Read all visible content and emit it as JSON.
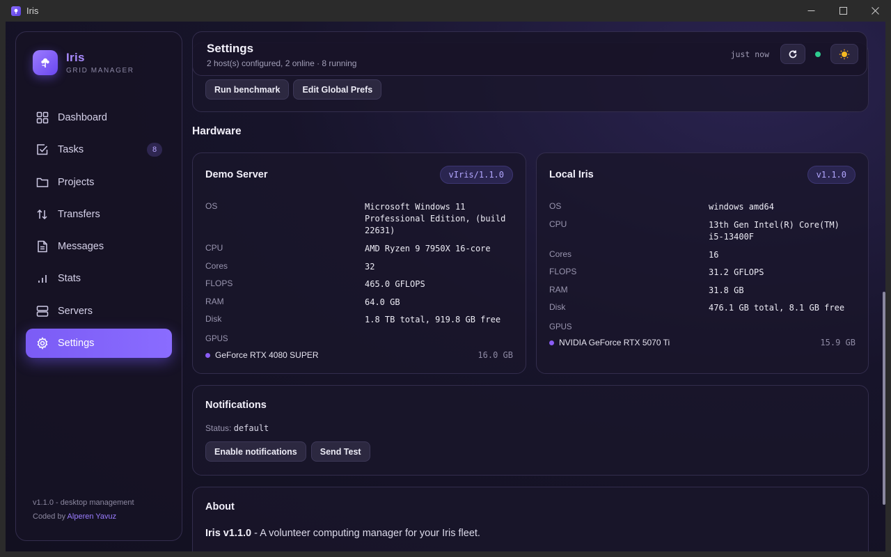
{
  "window": {
    "title": "Iris"
  },
  "brand": {
    "name": "Iris",
    "subtitle": "GRID MANAGER"
  },
  "nav": {
    "items": [
      {
        "label": "Dashboard",
        "icon": "grid-icon"
      },
      {
        "label": "Tasks",
        "icon": "checkbox-icon",
        "badge": "8"
      },
      {
        "label": "Projects",
        "icon": "folder-icon"
      },
      {
        "label": "Transfers",
        "icon": "transfer-icon"
      },
      {
        "label": "Messages",
        "icon": "document-icon"
      },
      {
        "label": "Stats",
        "icon": "bar-chart-icon"
      },
      {
        "label": "Servers",
        "icon": "server-icon"
      },
      {
        "label": "Settings",
        "icon": "gear-icon",
        "active": true
      }
    ]
  },
  "footer": {
    "version": "v1.1.0 - desktop management",
    "coded_by": "Coded by",
    "author": "Alperen Yavuz"
  },
  "header": {
    "title": "Settings",
    "subtitle": "2 host(s) configured, 2 online · 8 running",
    "last_update": "just now",
    "status_color": "#2ecc8f"
  },
  "actions": {
    "benchmark": "Run benchmark",
    "global_prefs": "Edit Global Prefs"
  },
  "hardware": {
    "title": "Hardware",
    "gpus_label": "GPUS",
    "labels": {
      "os": "OS",
      "cpu": "CPU",
      "cores": "Cores",
      "flops": "FLOPS",
      "ram": "RAM",
      "disk": "Disk"
    },
    "servers": [
      {
        "name": "Demo Server",
        "version": "vIris/1.1.0",
        "os": "Microsoft Windows 11 Professional Edition, (build 22631)",
        "cpu": "AMD Ryzen 9 7950X 16-core",
        "cores": "32",
        "flops": "465.0 GFLOPS",
        "ram": "64.0 GB",
        "disk": "1.8 TB total, 919.8 GB free",
        "gpu": {
          "name": "GeForce RTX 4080 SUPER",
          "memory": "16.0 GB"
        }
      },
      {
        "name": "Local Iris",
        "version": "v1.1.0",
        "os": "windows amd64",
        "cpu": "13th Gen Intel(R) Core(TM) i5-13400F",
        "cores": "16",
        "flops": "31.2 GFLOPS",
        "ram": "31.8 GB",
        "disk": "476.1 GB total, 8.1 GB free",
        "gpu": {
          "name": "NVIDIA GeForce RTX 5070 Ti",
          "memory": "15.9 GB"
        }
      }
    ]
  },
  "notifications": {
    "title": "Notifications",
    "status_label": "Status:",
    "status_value": "default",
    "enable": "Enable notifications",
    "send_test": "Send Test"
  },
  "about": {
    "title": "About",
    "product": "Iris v1.1.0",
    "description": " - A volunteer computing manager for your Iris fleet."
  },
  "colors": {
    "accent": "#7b5cf5",
    "brand_text": "#a98bff",
    "online": "#2ecc8f",
    "gpu_dot": "#8a5cf5"
  }
}
